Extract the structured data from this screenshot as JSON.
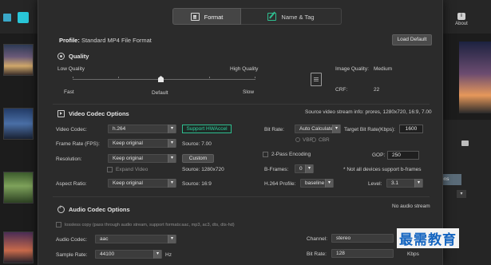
{
  "app": {
    "about_label": "About",
    "options_label": "ons",
    "about_icon": "about-icon"
  },
  "tabs": [
    {
      "label": "Format",
      "icon": "format-icon",
      "active": true
    },
    {
      "label": "Name & Tag",
      "icon": "name-tag-icon",
      "active": false
    }
  ],
  "profile": {
    "prefix": "Profile:",
    "name": "Standard MP4 File Format",
    "load_default": "Load Default"
  },
  "quality": {
    "title": "Quality",
    "low": "Low Quality",
    "high": "High Quality",
    "fast": "Fast",
    "default": "Default",
    "slow": "Slow",
    "image_quality_label": "Image Quality:",
    "image_quality_value": "Medium",
    "crf_label": "CRF:",
    "crf_value": "22"
  },
  "video": {
    "title": "Video Codec Options",
    "source_info": "Source video stream info: prores, 1280x720, 16:9, 7.00",
    "codec_label": "Video Codec:",
    "codec_value": "h.264",
    "hw_accel": "Support HWAccel",
    "frame_rate_label": "Frame Rate (FPS):",
    "frame_rate_value": "Keep original",
    "frame_rate_source": "Source: 7.00",
    "resolution_label": "Resolution:",
    "resolution_value": "Keep original",
    "custom_btn": "Custom",
    "expand_video": "Expand Video",
    "resolution_source": "Source: 1280x720",
    "aspect_label": "Aspect Ratio:",
    "aspect_value": "Keep original",
    "aspect_source": "Source: 16:9",
    "bitrate_label": "Bit Rate:",
    "bitrate_value": "Auto Calculate",
    "target_bitrate_label": "Target Bit Rate(Kbps):",
    "target_bitrate_value": "1600",
    "vbr": "VBR",
    "cbr": "CBR",
    "two_pass": "2-Pass Encoding",
    "gop_label": "GOP:",
    "gop_value": "250",
    "bframes_label": "B-Frames:",
    "bframes_value": "0",
    "bframes_note": "* Not all devices support b-frames",
    "profile_label": "H.264 Profile:",
    "profile_value": "baseline",
    "level_label": "Level:",
    "level_value": "3.1"
  },
  "audio": {
    "title": "Audio Codec Options",
    "no_stream": "No audio stream",
    "lossless_copy": "lossless copy (pass through audio stream, support formats:aac, mp3, ac3, dts, dts-hd)",
    "codec_label": "Audio Codec:",
    "codec_value": "aac",
    "channel_label": "Channel:",
    "channel_value": "stereo",
    "sample_label": "Sample Rate:",
    "sample_value": "44100",
    "sample_unit": "Hz",
    "bitrate_label": "Bit Rate:",
    "bitrate_value": "128",
    "bitrate_unit": "Kbps"
  },
  "watermark": "最需教育",
  "colors": {
    "accent_green": "#2fbd8f",
    "dialog_bg": "#2b2b2b",
    "watermark_blue": "#1565c0"
  }
}
